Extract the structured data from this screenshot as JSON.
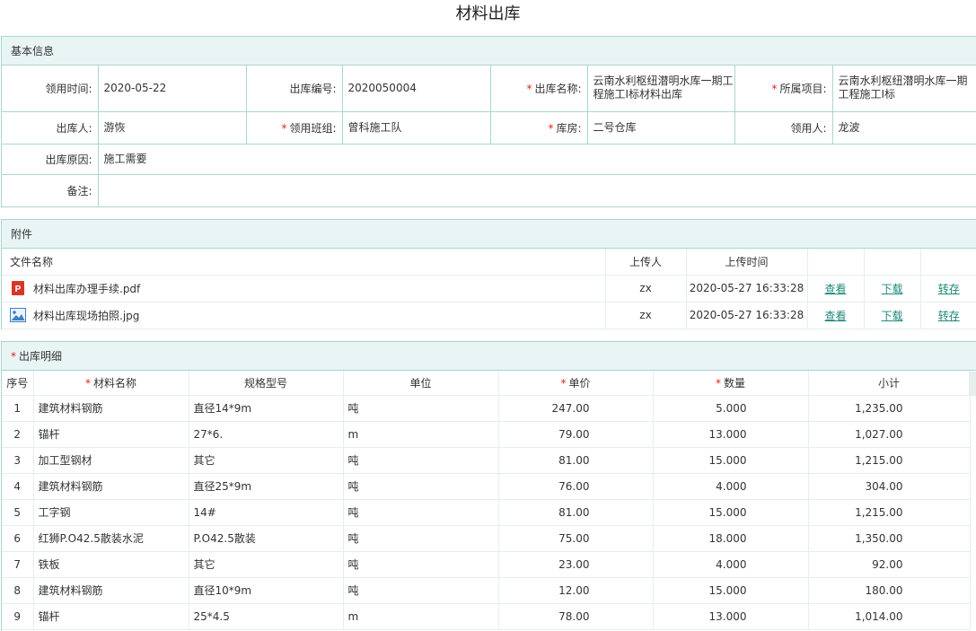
{
  "page": {
    "title": "材料出库"
  },
  "basic": {
    "header": "基本信息",
    "fields": {
      "receive_time": {
        "label": "领用时间:",
        "value": "2020-05-22"
      },
      "out_no": {
        "label": "出库编号:",
        "value": "2020050004"
      },
      "out_name": {
        "label": "出库名称:",
        "value": "云南水利枢纽潜明水库一期工程施工I标材料出库",
        "required": true
      },
      "project": {
        "label": "所属项目:",
        "value": "云南水利枢纽潜明水库一期工程施工I标",
        "required": true
      },
      "outbound_person": {
        "label": "出库人:",
        "value": "游恢"
      },
      "team": {
        "label": "领用班组:",
        "value": "曾科施工队",
        "required": true
      },
      "warehouse": {
        "label": "库房:",
        "value": "二号仓库",
        "required": true
      },
      "receiver": {
        "label": "领用人:",
        "value": "龙波"
      },
      "reason": {
        "label": "出库原因:",
        "value": "施工需要"
      },
      "remark": {
        "label": "备注:",
        "value": ""
      }
    }
  },
  "attachments": {
    "header": "附件",
    "columns": {
      "name": "文件名称",
      "uploader": "上传人",
      "time": "上传时间"
    },
    "actions": {
      "view": "查看",
      "download": "下载",
      "transfer": "转存"
    },
    "files": [
      {
        "icon": "pdf-icon",
        "name": "材料出库办理手续.pdf",
        "uploader": "zx",
        "time": "2020-05-27 16:33:28"
      },
      {
        "icon": "image-icon",
        "name": "材料出库现场拍照.jpg",
        "uploader": "zx",
        "time": "2020-05-27 16:33:28"
      }
    ]
  },
  "details": {
    "header": "出库明细",
    "columns": {
      "no": "序号",
      "name": "材料名称",
      "spec": "规格型号",
      "unit": "单位",
      "price": "单价",
      "qty": "数量",
      "subtotal": "小计"
    },
    "rows": [
      {
        "no": "1",
        "name": "建筑材料钢筋",
        "spec": "直径14*9m",
        "unit": "吨",
        "price": "247.00",
        "qty": "5.000",
        "subtotal": "1,235.00"
      },
      {
        "no": "2",
        "name": "锚杆",
        "spec": "27*6.",
        "unit": "m",
        "price": "79.00",
        "qty": "13.000",
        "subtotal": "1,027.00"
      },
      {
        "no": "3",
        "name": "加工型钢材",
        "spec": "其它",
        "unit": "吨",
        "price": "81.00",
        "qty": "15.000",
        "subtotal": "1,215.00"
      },
      {
        "no": "4",
        "name": "建筑材料钢筋",
        "spec": "直径25*9m",
        "unit": "吨",
        "price": "76.00",
        "qty": "4.000",
        "subtotal": "304.00"
      },
      {
        "no": "5",
        "name": "工字钢",
        "spec": "14#",
        "unit": "吨",
        "price": "81.00",
        "qty": "15.000",
        "subtotal": "1,215.00"
      },
      {
        "no": "6",
        "name": "红狮P.O42.5散装水泥",
        "spec": "P.O42.5散装",
        "unit": "吨",
        "price": "75.00",
        "qty": "18.000",
        "subtotal": "1,350.00"
      },
      {
        "no": "7",
        "name": "铁板",
        "spec": "其它",
        "unit": "吨",
        "price": "23.00",
        "qty": "4.000",
        "subtotal": "92.00"
      },
      {
        "no": "8",
        "name": "建筑材料钢筋",
        "spec": "直径10*9m",
        "unit": "吨",
        "price": "12.00",
        "qty": "15.000",
        "subtotal": "180.00"
      },
      {
        "no": "9",
        "name": "锚杆",
        "spec": "25*4.5",
        "unit": "m",
        "price": "78.00",
        "qty": "13.000",
        "subtotal": "1,014.00"
      }
    ]
  },
  "colors": {
    "border": "#a8d5d2",
    "header_bg": "#e9f5f4",
    "link": "#1f8a7a",
    "required": "#e02020"
  }
}
